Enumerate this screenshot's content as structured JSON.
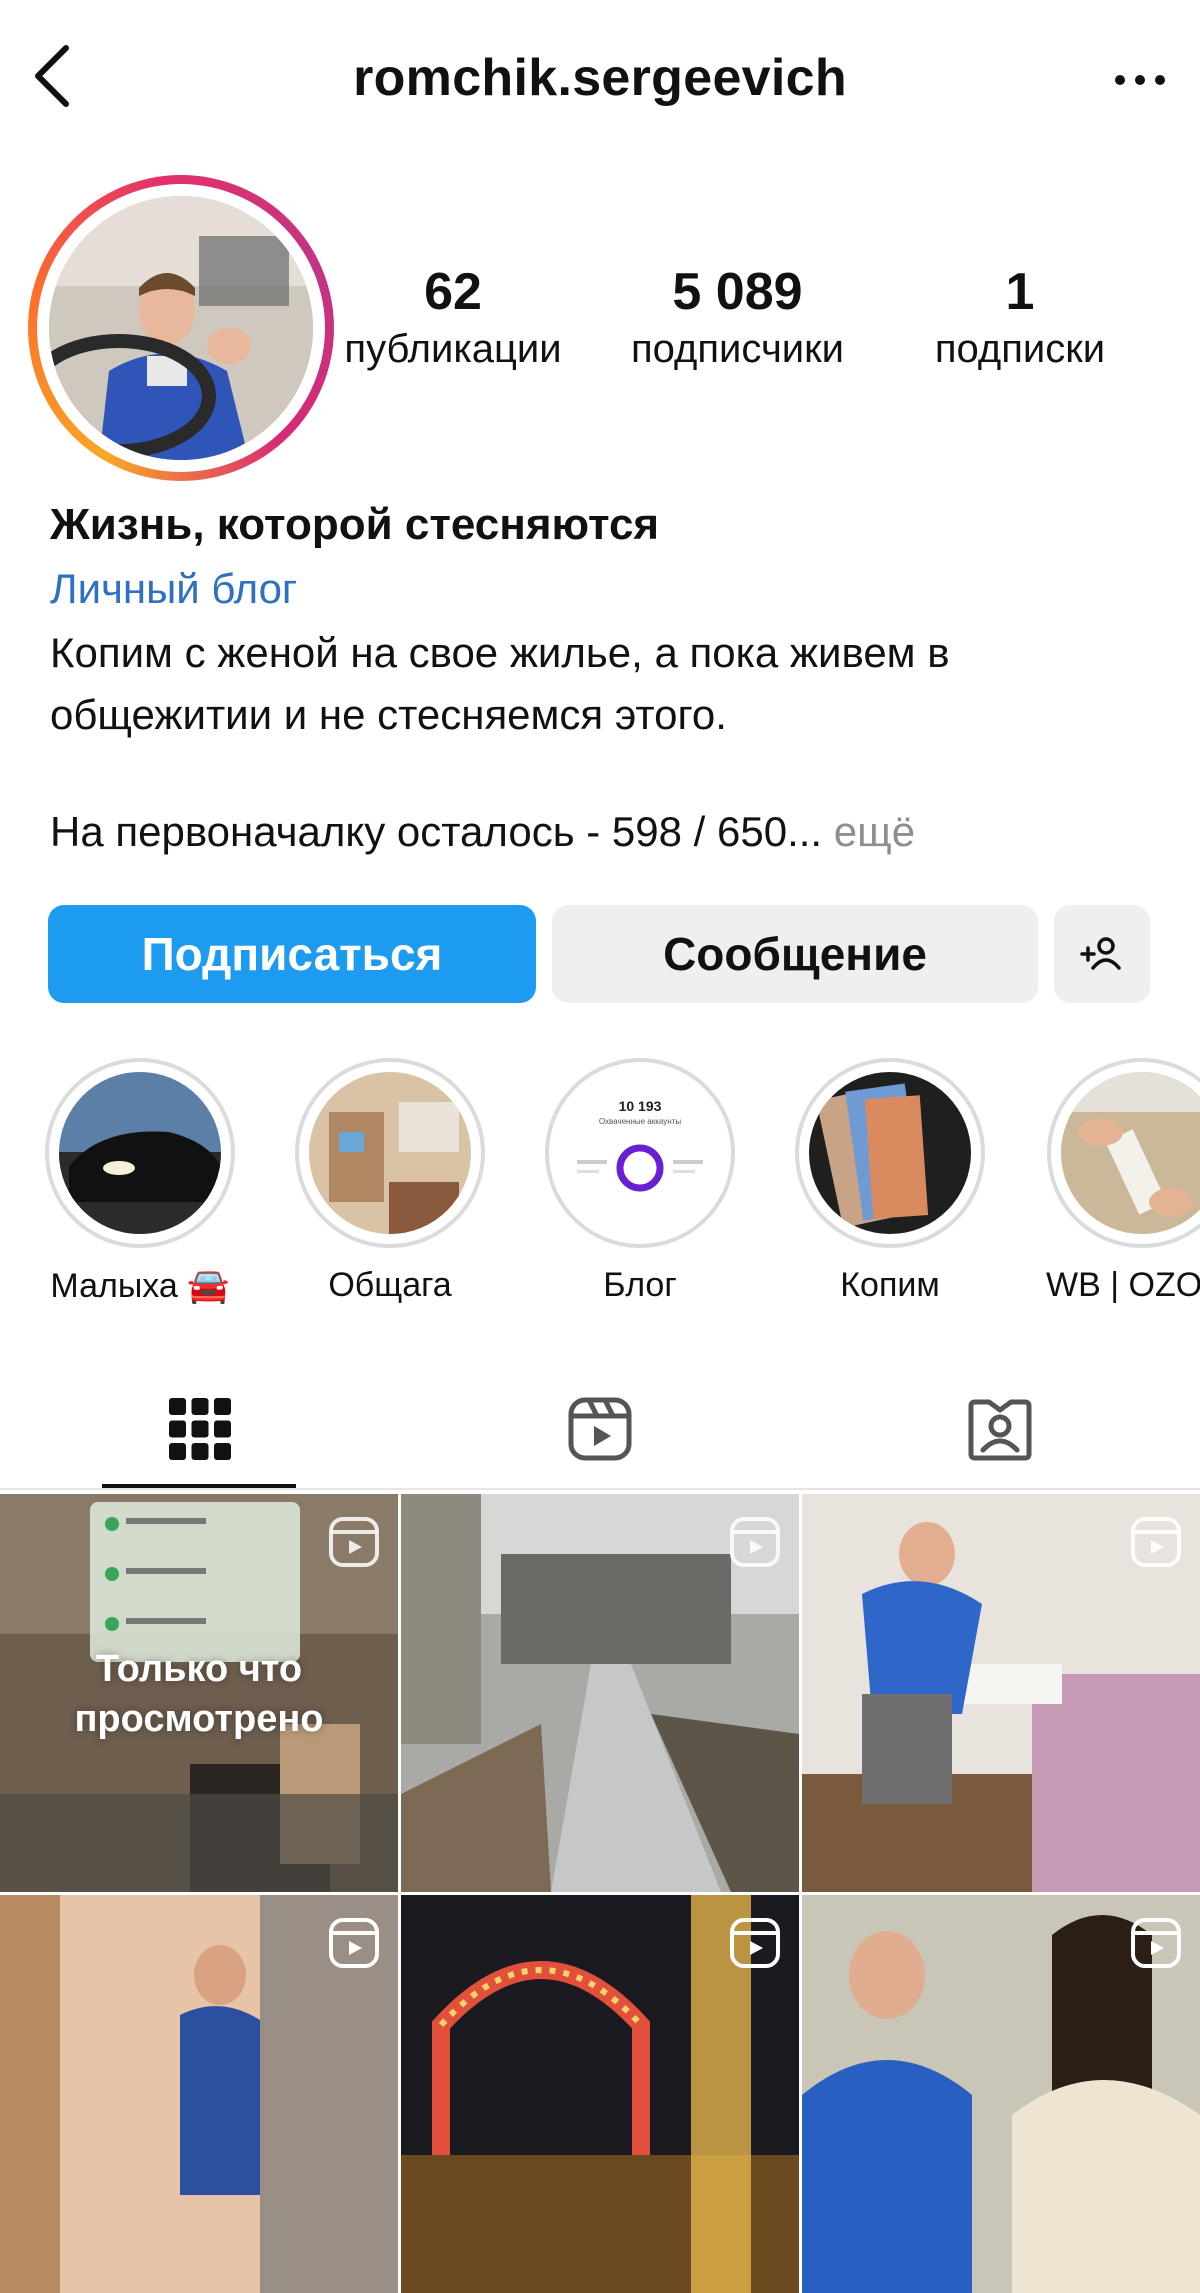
{
  "header": {
    "username": "romchik.sergeevich",
    "back_icon": "chevron-left-icon",
    "more_icon": "more-horizontal-icon"
  },
  "stats": [
    {
      "value": "62",
      "label": "публикации"
    },
    {
      "value": "5 089",
      "label": "подписчики"
    },
    {
      "value": "1",
      "label": "подписки"
    }
  ],
  "bio": {
    "name": "Жизнь, которой стесняются",
    "category": "Личный блог",
    "text": "Копим с женой на свое жилье, а пока живем в общежитии и не стесняемся этого.",
    "line2": "На первоначалку осталось - 598 / 650...",
    "more": " ещё"
  },
  "actions": {
    "follow": "Подписаться",
    "message": "Сообщение",
    "add_user_icon": "add-person-icon"
  },
  "highlights": [
    {
      "label": "Малыха 🚘"
    },
    {
      "label": "Общага"
    },
    {
      "label": "Блог",
      "stat_number": "10 193",
      "stat_caption": "Охваченные аккаунты"
    },
    {
      "label": "Копим"
    },
    {
      "label": "WB | OZO"
    }
  ],
  "tabs": [
    {
      "icon": "grid-icon",
      "active": true
    },
    {
      "icon": "reels-icon",
      "active": false
    },
    {
      "icon": "tagged-icon",
      "active": false
    }
  ],
  "grid": {
    "overlay_text_line1": "Только что",
    "overlay_text_line2": "просмотрено"
  },
  "colors": {
    "accent": "#1d9bf0",
    "link": "#2f70c1",
    "muted": "#8e8e8e",
    "button_bg": "#efefef"
  }
}
